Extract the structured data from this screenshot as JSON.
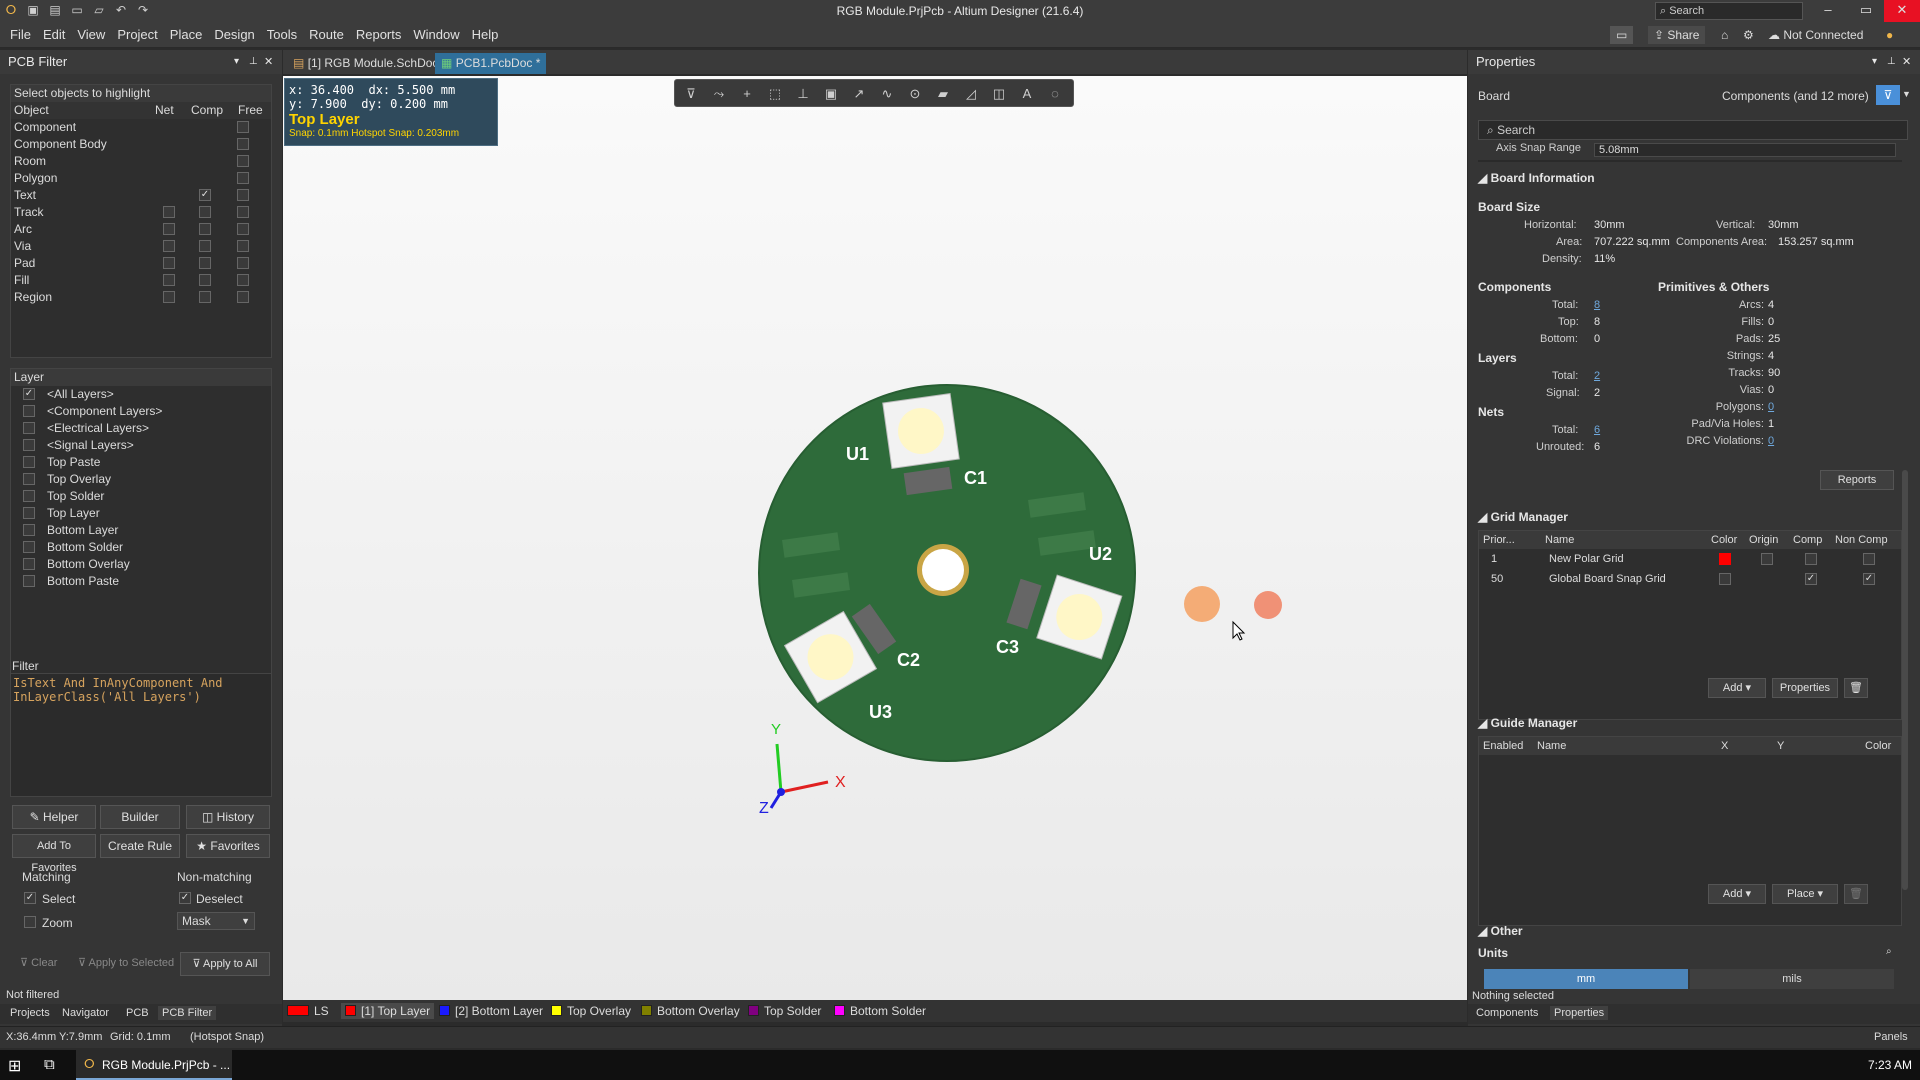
{
  "window": {
    "title": "RGB Module.PrjPcb - Altium Designer (21.6.4)",
    "search_placeholder": "Search",
    "min": "–",
    "max": "▭",
    "close": "✕"
  },
  "menu": [
    "File",
    "Edit",
    "View",
    "Project",
    "Place",
    "Design",
    "Tools",
    "Route",
    "Reports",
    "Window",
    "Help"
  ],
  "menubar_right": {
    "share": "Share",
    "not_connected": "Not Connected"
  },
  "left_panel": {
    "title": "PCB Filter",
    "select_header": "Select objects to highlight",
    "columns": [
      "Object",
      "Net",
      "Comp",
      "Free"
    ],
    "objects": [
      "Component",
      "Component Body",
      "Room",
      "Polygon",
      "Text",
      "Track",
      "Arc",
      "Via",
      "Pad",
      "Fill",
      "Region"
    ],
    "layer_header": "Layer",
    "layers": [
      "<All Layers>",
      "<Component Layers>",
      "<Electrical Layers>",
      "<Signal Layers>",
      "Top Paste",
      "Top Overlay",
      "Top Solder",
      "Top Layer",
      "Bottom Layer",
      "Bottom Solder",
      "Bottom Overlay",
      "Bottom Paste"
    ],
    "filter_header": "Filter",
    "filter_line1": "IsText And InAnyComponent And",
    "filter_line2": "InLayerClass('All Layers')",
    "buttons": {
      "helper": "Helper",
      "builder": "Builder",
      "history": "History",
      "add_fav": "Add To Favorites",
      "create_rule": "Create Rule",
      "favorites": "Favorites"
    },
    "matching": "Matching",
    "non_matching": "Non-matching",
    "select": "Select",
    "deselect": "Deselect",
    "zoom": "Zoom",
    "mask": "Mask",
    "clear": "Clear",
    "apply_selected": "Apply to Selected",
    "apply_all": "Apply to All",
    "status": "Not filtered",
    "bottom_tabs": [
      "Projects",
      "Navigator",
      "PCB",
      "PCB Filter"
    ]
  },
  "doc_tabs": [
    "[1] RGB Module.SchDoc",
    "PCB1.PcbDoc *"
  ],
  "coords": {
    "x": "x: 36.400",
    "dx": "dx:  5.500 mm",
    "y": "y:  7.900",
    "dy": "dy:  0.200 mm",
    "layer": "Top Layer",
    "snap": "Snap: 0.1mm Hotspot Snap: 0.203mm"
  },
  "pcb": {
    "labels": [
      "U1",
      "C1",
      "U2",
      "C2",
      "C3",
      "U3"
    ],
    "axes": {
      "x": "X",
      "y": "Y",
      "z": "Z"
    },
    "board_color": "#2e6b3a"
  },
  "layer_tabs": [
    {
      "name": "LS",
      "color": "#ff0000"
    },
    {
      "name": "[1] Top Layer",
      "color": "#ff0000"
    },
    {
      "name": "[2] Bottom Layer",
      "color": "#0000ff"
    },
    {
      "name": "Top Overlay",
      "color": "#ffff00"
    },
    {
      "name": "Bottom Overlay",
      "color": "#808000"
    },
    {
      "name": "Top Solder",
      "color": "#800080"
    },
    {
      "name": "Bottom Solder",
      "color": "#ff00ff"
    }
  ],
  "right_panel": {
    "title": "Properties",
    "board": "Board",
    "filter_label": "Components (and 12 more)",
    "search_placeholder": "Search",
    "axis_snap_label": "Axis Snap Range",
    "axis_snap_value": "5.08mm",
    "board_info": "Board Information",
    "board_size": "Board Size",
    "horizontal_l": "Horizontal:",
    "horizontal_v": "30mm",
    "vertical_l": "Vertical:",
    "vertical_v": "30mm",
    "area_l": "Area:",
    "area_v": "707.222 sq.mm",
    "comp_area_l": "Components Area:",
    "comp_area_v": "153.257 sq.mm",
    "density_l": "Density:",
    "density_v": "11%",
    "components": "Components",
    "comp_total_l": "Total:",
    "comp_total_v": "8",
    "comp_top_l": "Top:",
    "comp_top_v": "8",
    "comp_bottom_l": "Bottom:",
    "comp_bottom_v": "0",
    "layers": "Layers",
    "lay_total_l": "Total:",
    "lay_total_v": "2",
    "lay_signal_l": "Signal:",
    "lay_signal_v": "2",
    "nets": "Nets",
    "net_total_l": "Total:",
    "net_total_v": "6",
    "net_unrouted_l": "Unrouted:",
    "net_unrouted_v": "6",
    "prims": "Primitives & Others",
    "prim_rows": [
      [
        "Arcs:",
        "4"
      ],
      [
        "Fills:",
        "0"
      ],
      [
        "Pads:",
        "25"
      ],
      [
        "Strings:",
        "4"
      ],
      [
        "Tracks:",
        "90"
      ],
      [
        "Vias:",
        "0"
      ],
      [
        "Polygons:",
        "0"
      ],
      [
        "Pad/Via Holes:",
        "1"
      ],
      [
        "DRC Violations:",
        "0"
      ]
    ],
    "reports": "Reports",
    "grid_manager": "Grid Manager",
    "grid_cols": [
      "Prior...",
      "Name",
      "Color",
      "Origin",
      "Comp",
      "Non Comp"
    ],
    "grid_rows": [
      {
        "prio": "1",
        "name": "New Polar Grid",
        "color": "#ff0000"
      },
      {
        "prio": "50",
        "name": "Global Board Snap Grid",
        "color": "#3a3a3a"
      }
    ],
    "add": "Add",
    "properties": "Properties",
    "guide_manager": "Guide Manager",
    "guide_cols": [
      "Enabled",
      "Name",
      "X",
      "Y",
      "Color"
    ],
    "place": "Place",
    "other": "Other",
    "units": "Units",
    "mm": "mm",
    "mils": "mils",
    "nothing_selected": "Nothing selected",
    "bottom_tabs": [
      "Components",
      "Properties"
    ]
  },
  "status": {
    "coords": "X:36.4mm Y:7.9mm",
    "grid": "Grid: 0.1mm",
    "snap": "(Hotspot Snap)",
    "panels": "Panels"
  },
  "taskbar": {
    "app": "RGB Module.PrjPcb - ...",
    "time": "7:23 AM"
  }
}
